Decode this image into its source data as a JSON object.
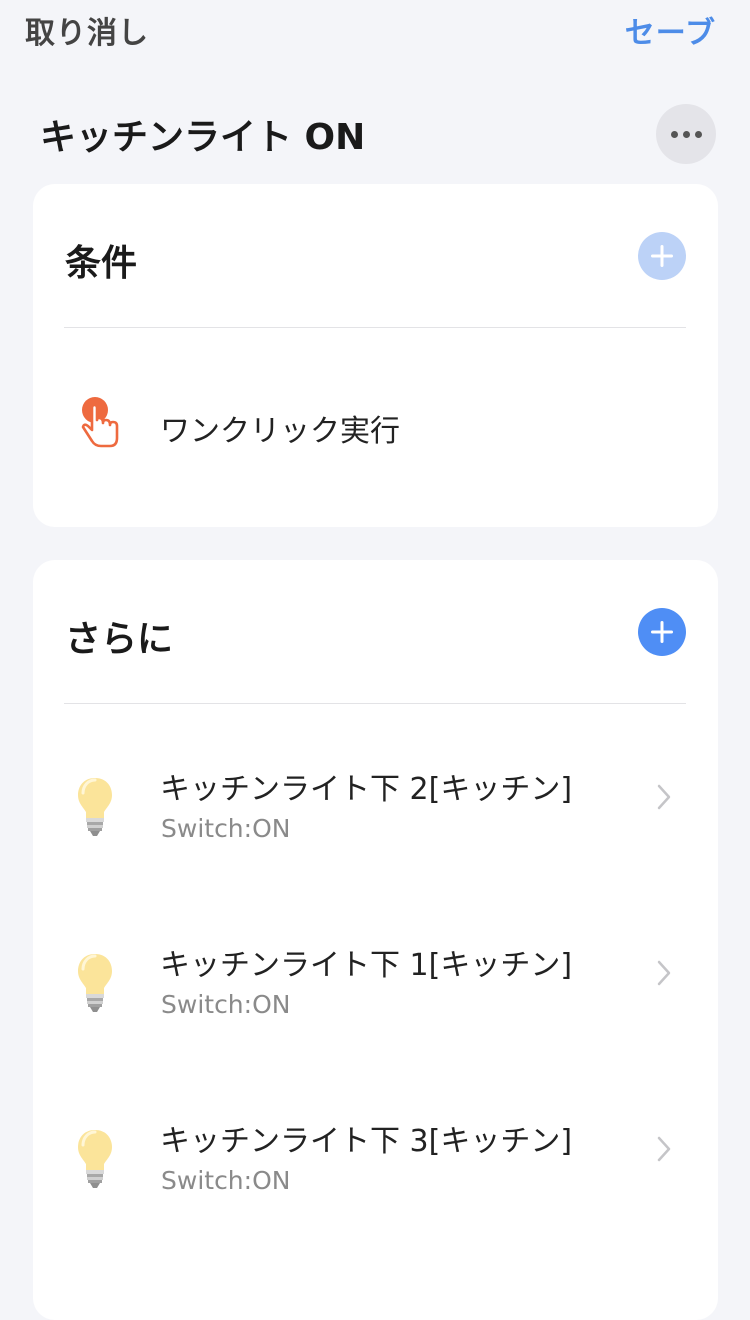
{
  "topbar": {
    "cancel_label": "取り消し",
    "save_label": "セーブ"
  },
  "scene": {
    "title": "キッチンライト ON"
  },
  "conditions": {
    "title": "条件",
    "items": [
      {
        "label": "ワンクリック実行",
        "icon": "tap-hand-icon"
      }
    ]
  },
  "actions": {
    "title": "さらに",
    "items": [
      {
        "name": "キッチンライト下 2[キッチン]",
        "status": "Switch:ON",
        "icon": "light-bulb-icon"
      },
      {
        "name": "キッチンライト下 1[キッチン]",
        "status": "Switch:ON",
        "icon": "light-bulb-icon"
      },
      {
        "name": "キッチンライト下 3[キッチン]",
        "status": "Switch:ON",
        "icon": "light-bulb-icon"
      }
    ]
  },
  "colors": {
    "accent": "#4d8ce8",
    "add_button_disabled": "#bcd2f7",
    "add_button_active": "#4f8ef5",
    "tap_icon": "#ee6a3f",
    "background": "#f4f5f9"
  }
}
